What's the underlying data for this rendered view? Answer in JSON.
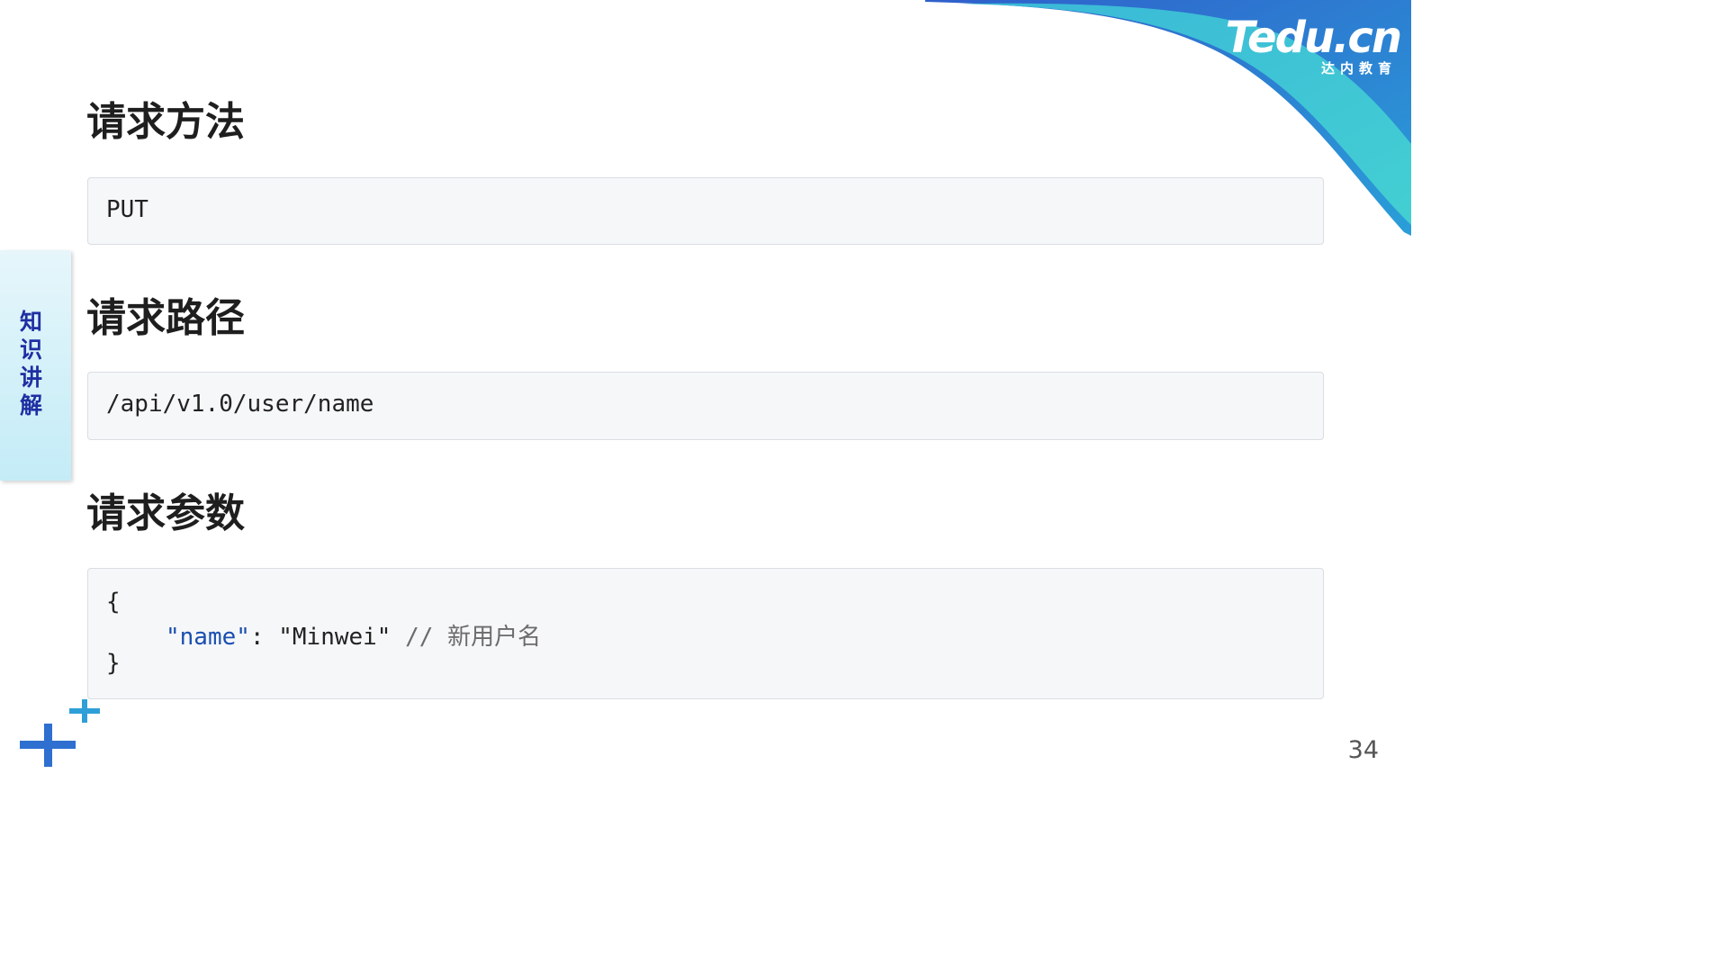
{
  "colors": {
    "swoosh_dark": "#2f5fcb",
    "swoosh_mid": "#2a9fd8",
    "swoosh_light": "#3cc7d0",
    "tab_text": "#1f2fa2",
    "plus": "#2e6fd0",
    "code_key": "#1a4fb0"
  },
  "logo": {
    "main": "Tedu.cn",
    "sub": "达内教育"
  },
  "side_tab": {
    "label": "知识讲解"
  },
  "sections": [
    {
      "heading": "请求方法",
      "code": "PUT"
    },
    {
      "heading": "请求路径",
      "code": "/api/v1.0/user/name"
    },
    {
      "heading": "请求参数",
      "code_lines": {
        "open": "{",
        "key": "\"name\"",
        "colon": ": ",
        "value": "\"Minwei\"",
        "comment": "// 新用户名",
        "close": "}"
      }
    }
  ],
  "decoration_icons": [
    "plus-icon-large",
    "plus-icon-small"
  ],
  "page_number": "34"
}
